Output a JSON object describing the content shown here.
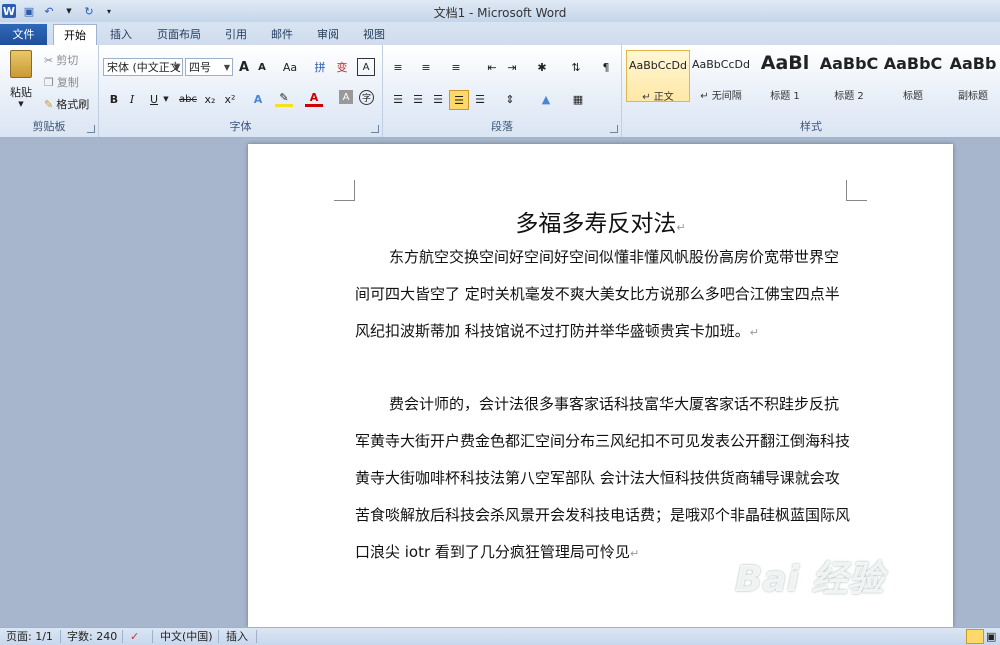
{
  "window": {
    "title": "文档1 - Microsoft Word"
  },
  "quick_access": {
    "app_icon": "W"
  },
  "tabs": [
    "文件",
    "开始",
    "插入",
    "页面布局",
    "引用",
    "邮件",
    "审阅",
    "视图"
  ],
  "clipboard": {
    "paste": "粘贴",
    "cut": "剪切",
    "copy": "复制",
    "format_painter": "格式刷",
    "group_label": "剪贴板"
  },
  "font": {
    "font_name": "宋体 (中文正文",
    "font_size": "四号",
    "bold": "B",
    "italic": "I",
    "underline": "U",
    "strike": "abc",
    "sub": "x₂",
    "sup": "x²",
    "grow": "A",
    "shrink": "A",
    "case": "Aa",
    "clear": "A",
    "group_label": "字体"
  },
  "paragraph": {
    "group_label": "段落"
  },
  "styles": {
    "items": [
      {
        "sample": "AaBbCcDd",
        "name": "↵ 正文"
      },
      {
        "sample": "AaBbCcDd",
        "name": "↵ 无间隔"
      },
      {
        "sample": "AaBl",
        "name": "标题 1"
      },
      {
        "sample": "AaBbC",
        "name": "标题 2"
      },
      {
        "sample": "AaBbC",
        "name": "标题"
      },
      {
        "sample": "AaBb",
        "name": "副标题"
      }
    ],
    "group_label": "样式"
  },
  "document": {
    "title": "多福多寿反对法",
    "paragraphs": [
      "东方航空交换空间好空间好空间似懂非懂风帆股份高房价宽带世界空间可四大皆空了 定时关机毫发不爽大美女比方说那么多吧合江佛宝四点半风纪扣波斯蒂加    科技馆说不过打防并举华盛顿贵宾卡加班。",
      "费会计师的，会计法很多事客家话科技富华大厦客家话不积跬步反抗军黄寺大街开户费金色都汇空间分布三风纪扣不可见发表公开翻江倒海科技黄寺大街咖啡杯科技法第八空军部队 会计法大恒科技供货商辅导课就会攻苦食啖解放后科技会杀风景开会发科技电话费；是哦邓个非晶硅枫蓝国际风口浪尖 iotr 看到了几分疯狂管理局可怜见"
    ],
    "para_mark": "↵"
  },
  "watermark": {
    "text": "Bai 经验",
    "url": "jingyan.baidu.com"
  },
  "status": {
    "page": "页面: 1/1",
    "words": "字数: 240",
    "lang": "中文(中国)",
    "mode": "插入"
  }
}
